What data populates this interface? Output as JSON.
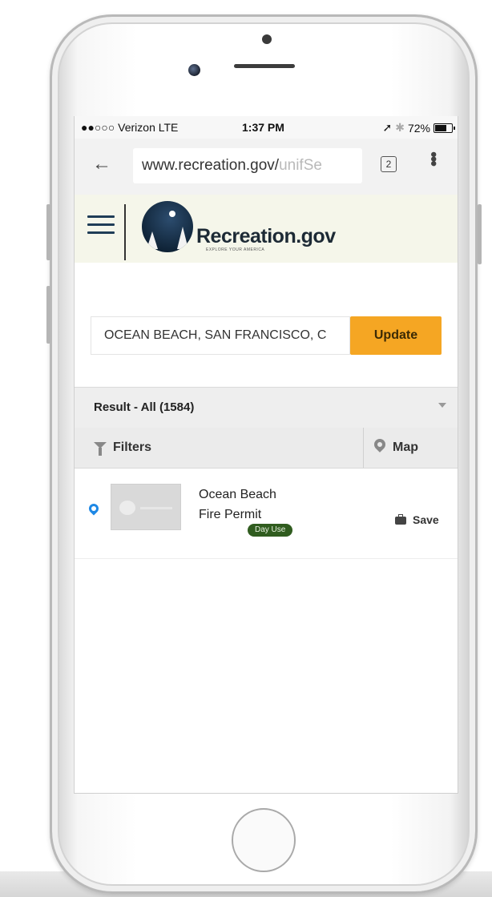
{
  "status_bar": {
    "carrier": "●●○○○ Verizon  LTE",
    "time": "1:37 PM",
    "battery": "72%",
    "battery_level": 0.72
  },
  "browser": {
    "url_main": "www.recreation.gov/",
    "url_faded": "unifSe",
    "tab_count": "2"
  },
  "site": {
    "name": "Recreation.gov",
    "tagline": "EXPLORE YOUR AMERICA",
    "brand_color": "#1f3d57"
  },
  "search": {
    "value": "OCEAN BEACH, SAN FRANCISCO, C",
    "button_label": "Update",
    "button_color": "#f5a623"
  },
  "results": {
    "summary": "Result - All (1584)",
    "filters_label": "Filters",
    "map_label": "Map",
    "items": [
      {
        "title_line1": "Ocean Beach",
        "title_line2": "Fire Permit",
        "badge": "Day Use",
        "badge_color": "#305c1f",
        "save_label": "Save"
      }
    ]
  },
  "icons": [
    "back-arrow-icon",
    "tabs-icon",
    "more-vert-icon",
    "hamburger-menu-icon",
    "filter-icon",
    "map-pin-icon",
    "location-pin-icon",
    "briefcase-icon",
    "dropdown-caret-icon"
  ]
}
